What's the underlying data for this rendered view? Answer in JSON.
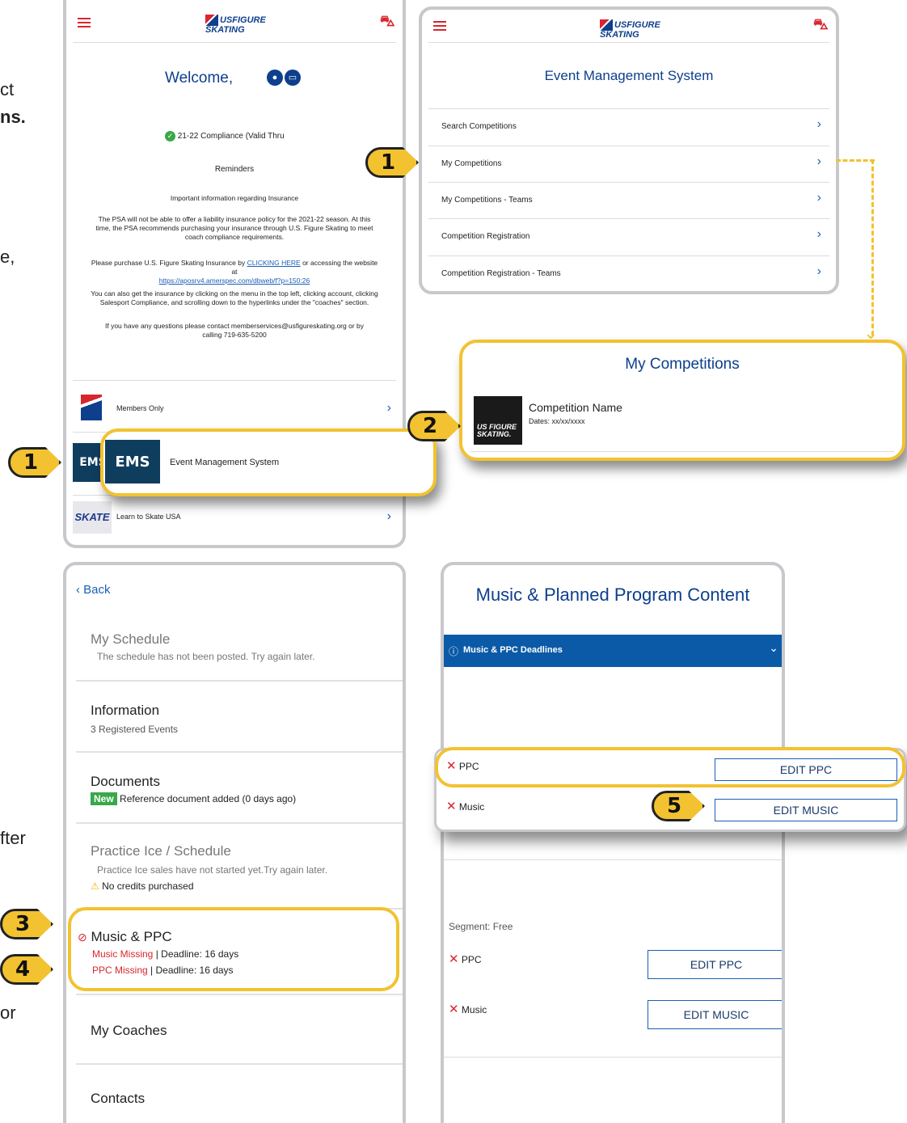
{
  "side_text": {
    "t1": "ct",
    "t2": "ns.",
    "t3": "e,",
    "t4": "fter",
    "t5": "or"
  },
  "badges": {
    "b1": "1",
    "b1b": "1",
    "b2": "2",
    "b3": "3",
    "b4": "4",
    "b5": "5"
  },
  "screen1": {
    "logo": "USFIGURE SKATING",
    "welcome": "Welcome,",
    "compliance": "21-22 Compliance (Valid Thru",
    "reminders": "Reminders",
    "insurance_title": "Important information regarding Insurance",
    "para1": "The PSA will not be able to offer a liability insurance policy for the 2021-22 season. At this time, the PSA recommends purchasing your insurance through U.S. Figure Skating to meet coach compliance requirements.",
    "para2_a": "Please purchase U.S. Figure Skating Insurance by ",
    "para2_link": "CLICKING HERE",
    "para2_b": " or accessing the website at",
    "para2_url": "https://aposrv4.amerspec.com/dbweb/f?p=150:26",
    "para3": "You can also get the insurance by clicking on the menu in the top left, clicking account, clicking Salesport Compliance, and scrolling down to the hyperlinks under the \"coaches\" section.",
    "para4": "If you have any questions please contact memberservices@usfigureskating.org or by calling 719-635-5200",
    "members_only": "Members Only",
    "ems_logo": "EMS",
    "ems_label": "Event Management System",
    "learn_to_skate": "Learn to Skate USA",
    "skate_logo": "SKATE"
  },
  "screen2": {
    "logo": "USFIGURE SKATING",
    "title": "Event Management System",
    "items": [
      "Search Competitions",
      "My Competitions",
      "My Competitions - Teams",
      "Competition Registration",
      "Competition Registration - Teams"
    ]
  },
  "my_competitions": {
    "title": "My Competitions",
    "comp_name": "Competition Name",
    "dates": "Dates: xx/xx/xxxx",
    "logo": "US FIGURE SKATING."
  },
  "screen3": {
    "back": "Back",
    "schedule_title": "My Schedule",
    "schedule_sub": "The schedule has not been posted. Try again later.",
    "info_title": "Information",
    "info_sub": "3 Registered Events",
    "docs_title": "Documents",
    "docs_badge": "New",
    "docs_sub": "Reference document added (0 days ago)",
    "practice_title": "Practice Ice / Schedule",
    "practice_sub": "Practice Ice sales have not started yet.Try again later.",
    "practice_warn": "No credits purchased",
    "music_title": "Music & PPC",
    "music_missing": "Music Missing",
    "music_deadline": "| Deadline: 16 days",
    "ppc_missing": "PPC Missing",
    "ppc_deadline": "| Deadline: 16 days",
    "coaches": "My Coaches",
    "contacts": "Contacts"
  },
  "screen4": {
    "title": "Music & Planned Program Content",
    "deadlines_bar": "Music & PPC Deadlines",
    "ppc_label": "PPC",
    "edit_ppc": "EDIT PPC",
    "music_label": "Music",
    "edit_music": "EDIT MUSIC",
    "segment": "Segment: Free",
    "ppc_label2": "PPC",
    "edit_ppc2": "EDIT PPC",
    "music_label2": "Music",
    "edit_music2": "EDIT MUSIC"
  },
  "colors": {
    "accent": "#f2c230",
    "brand_red": "#d8262e",
    "brand_blue": "#0d3f8c",
    "link_blue": "#1a5fb4",
    "bar_blue": "#0b5aa8"
  }
}
